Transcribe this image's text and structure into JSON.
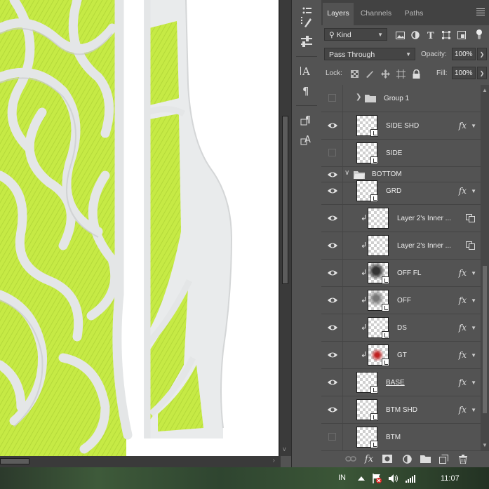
{
  "panel": {
    "tabs": [
      {
        "label": "Layers",
        "active": true
      },
      {
        "label": "Channels",
        "active": false
      },
      {
        "label": "Paths",
        "active": false
      }
    ],
    "filter": {
      "kind_label": "Kind"
    },
    "blend_mode": "Pass Through",
    "opacity_label": "Opacity:",
    "opacity_value": "100%",
    "lock_label": "Lock:",
    "fill_label": "Fill:",
    "fill_value": "100%"
  },
  "layers": [
    {
      "name": "Group 1",
      "type": "group",
      "visible": false,
      "collapsed": true
    },
    {
      "name": "SIDE SHD",
      "type": "smart",
      "visible": true,
      "fx": true
    },
    {
      "name": "SIDE",
      "type": "smart",
      "visible": false,
      "fx": false
    },
    {
      "name": "BOTTOM",
      "type": "group",
      "visible": true,
      "collapsed": false
    },
    {
      "name": "GRD",
      "type": "smart",
      "visible": true,
      "fx": true
    },
    {
      "name": "Layer 2's Inner ...",
      "type": "clipped-smartobj",
      "visible": true,
      "fx": false
    },
    {
      "name": "Layer 2's Inner ...",
      "type": "clipped-smartobj",
      "visible": true,
      "fx": false
    },
    {
      "name": "OFF FL",
      "type": "clipped",
      "visible": true,
      "fx": true
    },
    {
      "name": "OFF",
      "type": "clipped",
      "visible": true,
      "fx": true
    },
    {
      "name": "DS",
      "type": "clipped",
      "visible": true,
      "fx": true
    },
    {
      "name": "GT",
      "type": "clipped",
      "visible": true,
      "fx": true
    },
    {
      "name": "BASE",
      "type": "smart",
      "visible": true,
      "fx": true,
      "underlined": true
    },
    {
      "name": "BTM SHD",
      "type": "smart",
      "visible": true,
      "fx": true
    },
    {
      "name": "BTM",
      "type": "smart",
      "visible": false,
      "fx": false
    }
  ],
  "fx_label": "fx",
  "taskbar": {
    "language": "IN",
    "time": "11:07"
  },
  "colors": {
    "sole_green": "#c8ec4a",
    "sole_rubber": "#e7e9ea",
    "panel_bg": "#535353"
  }
}
